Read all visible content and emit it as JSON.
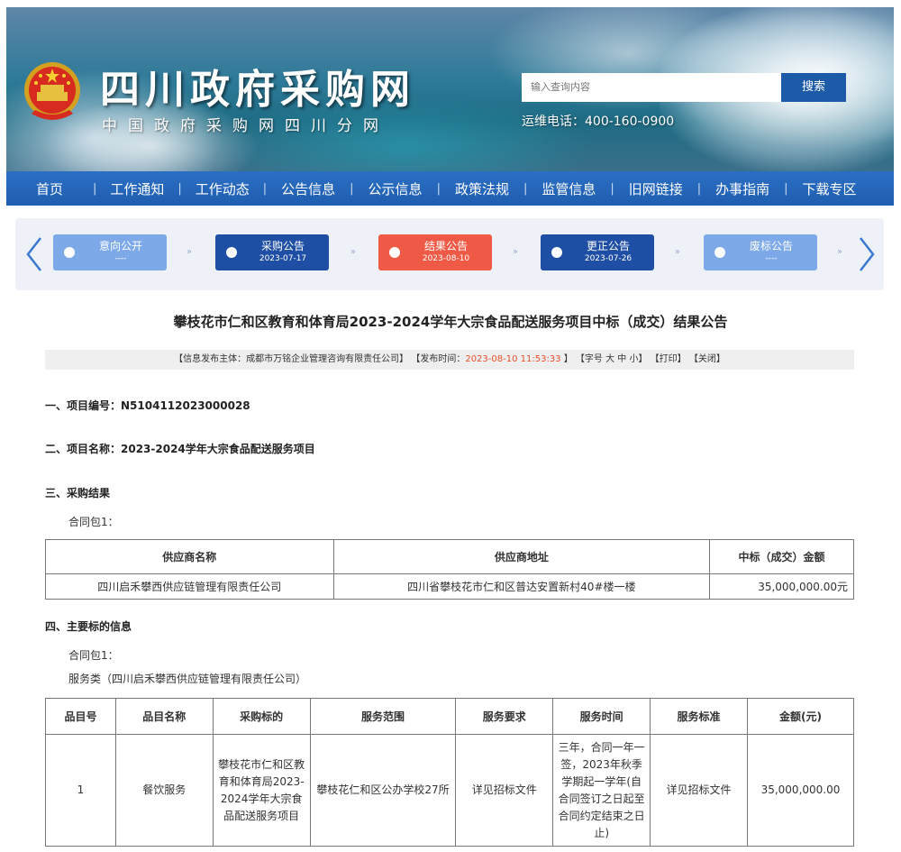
{
  "header": {
    "site_title": "四川政府采购网",
    "site_subtitle": "中国政府采购网四川分网",
    "search_placeholder": "输入查询内容",
    "search_button": "搜索",
    "hotline": "运维电话：400-160-0900"
  },
  "nav": [
    "首页",
    "工作通知",
    "工作动态",
    "公告信息",
    "公示信息",
    "政策法规",
    "监管信息",
    "旧网链接",
    "办事指南",
    "下载专区"
  ],
  "steps": [
    {
      "label": "意向公开",
      "date": "----",
      "color": "#7da9e8",
      "icon": "minus-icon"
    },
    {
      "label": "采购公告",
      "date": "2023-07-17",
      "color": "#1f4fa5",
      "icon": "check-icon"
    },
    {
      "label": "结果公告",
      "date": "2023-08-10",
      "color": "#ee5a45",
      "icon": "clock-icon"
    },
    {
      "label": "更正公告",
      "date": "2023-07-26",
      "color": "#1f4fa5",
      "icon": "check-icon"
    },
    {
      "label": "废标公告",
      "date": "----",
      "color": "#7da9e8",
      "icon": "minus-icon"
    }
  ],
  "article": {
    "title": "攀枝花市仁和区教育和体育局2023-2024学年大宗食品配送服务项目中标（成交）结果公告",
    "meta": {
      "publisher": "【信息发布主体：成都市万铭企业管理咨询有限责任公司】",
      "time_prefix": "【发布时间：",
      "time_value": "2023-08-10 11:53:33",
      "time_suffix": "】",
      "font_size": "【字号 大 中 小】",
      "print": "【打印】",
      "close": "【关闭】"
    },
    "section1": "一、项目编号：N5104112023000028",
    "section2": "二、项目名称：2023-2024学年大宗食品配送服务项目",
    "section3": "三、采购结果",
    "section3_package": "合同包1：",
    "result_table": {
      "headers": [
        "供应商名称",
        "供应商地址",
        "中标（成交）金额"
      ],
      "rows": [
        [
          "四川启禾攀西供应链管理有限责任公司",
          "四川省攀枝花市仁和区普达安置新村40#楼一楼",
          "35,000,000.00元"
        ]
      ]
    },
    "section4": "四、主要标的信息",
    "section4_package": "合同包1：",
    "section4_category": "服务类（四川启禾攀西供应链管理有限责任公司）",
    "item_table": {
      "headers": [
        "品目号",
        "品目名称",
        "采购标的",
        "服务范围",
        "服务要求",
        "服务时间",
        "服务标准",
        "金额(元)"
      ],
      "rows": [
        [
          "1",
          "餐饮服务",
          "攀枝花市仁和区教育和体育局2023-2024学年大宗食品配送服务项目",
          "攀枝花仁和区公办学校27所",
          "详见招标文件",
          "三年，合同一年一签，2023年秋季学期起一学年(自合同签订之日起至合同约定结束之日止)",
          "详见招标文件",
          "35,000,000.00"
        ]
      ]
    }
  }
}
